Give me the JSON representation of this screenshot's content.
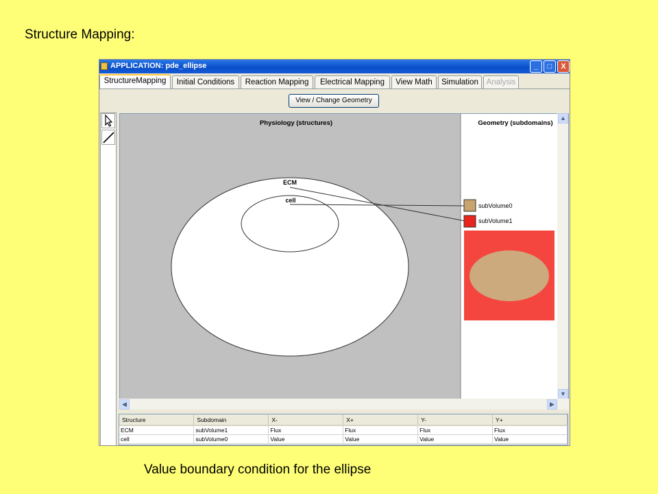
{
  "slide": {
    "title": "Structure Mapping:",
    "caption": "Value boundary condition for the ellipse"
  },
  "window": {
    "title": "APPLICATION: pde_ellipse",
    "buttons": {
      "minimize": "_",
      "maximize": "□",
      "close": "X"
    }
  },
  "tabs": [
    {
      "label": "StructureMapping",
      "state": "active"
    },
    {
      "label": "Initial Conditions",
      "state": "normal"
    },
    {
      "label": "Reaction Mapping",
      "state": "normal"
    },
    {
      "label": "Electrical Mapping",
      "state": "normal"
    },
    {
      "label": "View Math",
      "state": "normal"
    },
    {
      "label": "Simulation",
      "state": "normal"
    },
    {
      "label": "Analysis",
      "state": "disabled"
    }
  ],
  "toolbar": {
    "view_change_geometry": "View / Change Geometry",
    "tools": [
      "select-arrow-icon",
      "line-draw-icon"
    ]
  },
  "physiology": {
    "header": "Physiology (structures)",
    "structures": [
      "ECM",
      "cell"
    ]
  },
  "geometry": {
    "header": "Geometry (subdomains)",
    "subdomains": [
      {
        "name": "subVolume0",
        "color": "#C8A46E"
      },
      {
        "name": "subVolume1",
        "color": "#E8241C"
      }
    ],
    "preview": {
      "outer_color": "#F4463F",
      "inner_color": "#CDAA7D"
    }
  },
  "table": {
    "columns": [
      "Structure",
      "Subdomain",
      "X-",
      "X+",
      "Y-",
      "Y+"
    ],
    "rows": [
      [
        "ECM",
        "subVolume1",
        "Flux",
        "Flux",
        "Flux",
        "Flux"
      ],
      [
        "cell",
        "subVolume0",
        "Value",
        "Value",
        "Value",
        "Value"
      ]
    ]
  },
  "colors": {
    "slide_background": "#FFFF77",
    "canvas_background": "#C0C0C0",
    "titlebar_blue": "#0A4FC9"
  }
}
